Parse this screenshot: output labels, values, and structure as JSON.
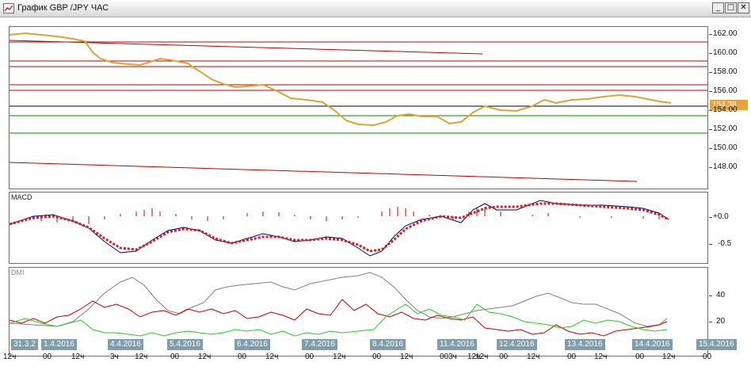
{
  "window": {
    "title": "График GBP /JPY  ЧАС",
    "buttons": [
      "_",
      "□",
      "✕"
    ]
  },
  "price_panel": {
    "scale": [
      "162.00",
      "160.00",
      "158.00",
      "156.00",
      "154.00",
      "152.00",
      "150.00",
      "148.00"
    ],
    "current_price": "154.38",
    "colors": {
      "price": "#d9a534",
      "resistance": "#c00000",
      "support": "#008800",
      "current": "#000000",
      "tag": "#e8a33a"
    }
  },
  "macd_panel": {
    "label": "MACD",
    "scale": [
      "+0.0",
      "-0.5"
    ],
    "colors": {
      "signal": "#d42020",
      "macd": "#000080",
      "histogram": "#c00000"
    }
  },
  "dmi_panel": {
    "label": "DMI",
    "scale": [
      "40",
      "20"
    ],
    "colors": {
      "adx": "#808080",
      "plus_di": "#c00000",
      "minus_di": "#22cc22"
    }
  },
  "time_axis": {
    "dates": [
      "31.3.2",
      "1.4.2016",
      "4.4.2016",
      "5.4.2016",
      "6.4.2016",
      "7.4.2016",
      "8.4.2016",
      "11.4.2016",
      "12.4.2016",
      "13.4.2016",
      "14.4.2016",
      "15.4.2016"
    ],
    "hours": [
      "12ч",
      "00",
      "12ч",
      "3ч",
      "12ч",
      "00",
      "12ч",
      "00",
      "12ч",
      "00",
      "12ч",
      "00",
      "12ч",
      "00",
      "12ч",
      "3ч",
      "12ч",
      "00",
      "12ч",
      "00",
      "12ч",
      "00",
      "12ч",
      "00"
    ]
  }
}
